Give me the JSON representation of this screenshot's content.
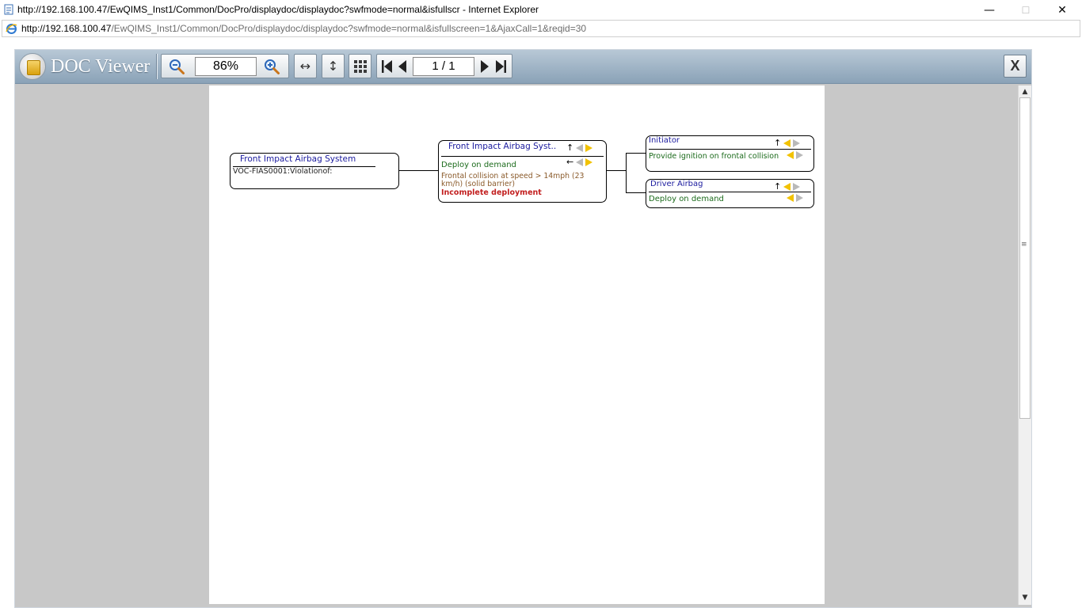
{
  "window": {
    "title": "http://192.168.100.47/EwQIMS_Inst1/Common/DocPro/displaydoc/displaydoc?swfmode=normal&isfullscr - Internet Explorer",
    "address_host": "http://192.168.100.47",
    "address_path": "/EwQIMS_Inst1/Common/DocPro/displaydoc/displaydoc?swfmode=normal&isfullscreen=1&AjaxCall=1&reqid=30",
    "minimize": "—",
    "maximize": "☐",
    "close": "✕"
  },
  "viewer": {
    "app_title": "DOC Viewer",
    "zoom_value": "86%",
    "page_value": "1 / 1",
    "close_label": "X"
  },
  "diagram": {
    "root": {
      "title": "Front Impact Airbag System",
      "text": "VOC-FIAS0001:Violationof:"
    },
    "middle": {
      "title": "Front Impact Airbag Syst..",
      "function": "Deploy on demand",
      "condition": "Frontal collision at speed > 14mph (23 km/h) (solid barrier)",
      "failure": "Incomplete deployment",
      "up_arrow": "↑",
      "left_arrow": "←"
    },
    "initiator": {
      "title": "Initiator",
      "function": "Provide ignition on frontal collision",
      "up_arrow": "↑"
    },
    "driver_airbag": {
      "title": "Driver Airbag",
      "function": "Deploy on demand",
      "up_arrow": "↑"
    }
  },
  "colors": {
    "toolbar_top": "#b8c8d6",
    "toolbar_bottom": "#8aa2b7",
    "viewer_bg": "#c8c8c8",
    "title_blue": "#1a1a9e",
    "function_green": "#1c6b1c",
    "failure_red": "#c21f1f",
    "nav_arrow_yellow": "#f2c200"
  }
}
